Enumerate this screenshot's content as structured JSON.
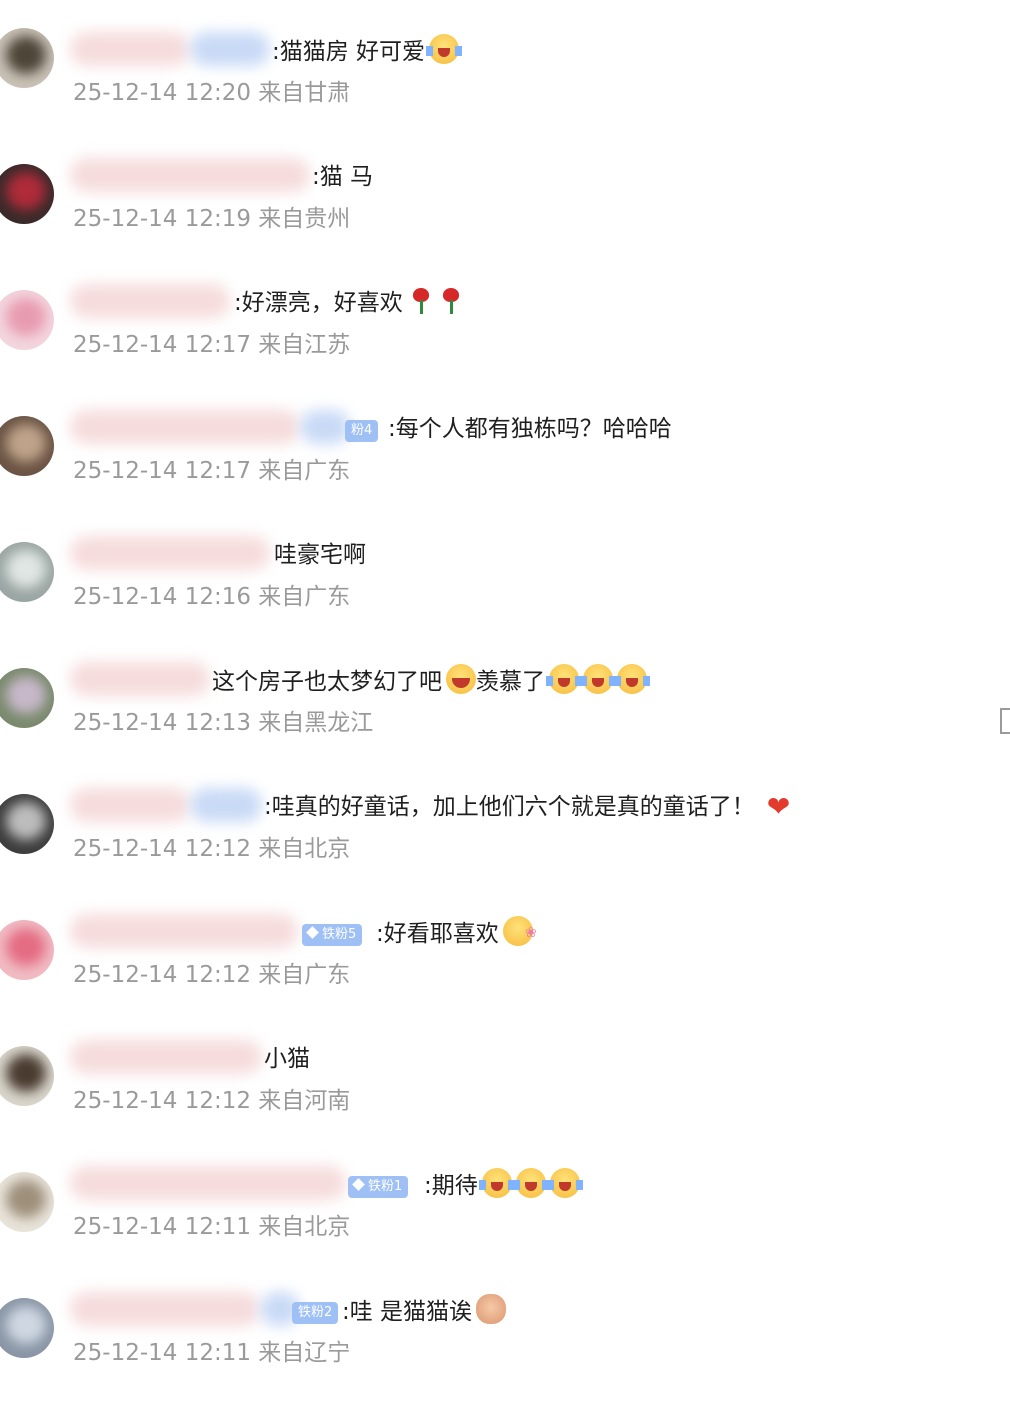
{
  "comments": [
    {
      "id": "c1",
      "text": ":猫猫房 好可爱",
      "emoji": [
        "cry"
      ],
      "badge": "",
      "meta": "25-12-14 12:20 来自甘肃"
    },
    {
      "id": "c2",
      "text": ":猫 马",
      "emoji": [],
      "badge": "",
      "meta": "25-12-14 12:19 来自贵州"
    },
    {
      "id": "c3",
      "text": ":好漂亮，好喜欢",
      "emoji": [
        "rose",
        "rose"
      ],
      "badge": "",
      "meta": "25-12-14 12:17 来自江苏"
    },
    {
      "id": "c4",
      "text": ":每个人都有独栋吗？哈哈哈",
      "emoji": [],
      "badge": "粉4",
      "meta": "25-12-14 12:17 来自广东"
    },
    {
      "id": "c5",
      "text": "哇豪宅啊",
      "emoji": [],
      "badge": "",
      "meta": "25-12-14 12:16 来自广东"
    },
    {
      "id": "c6",
      "text": "这个房子也太梦幻了吧",
      "text2": "羡慕了",
      "emoji": [
        "laugh"
      ],
      "emoji2": [
        "cry",
        "cry",
        "cry"
      ],
      "badge": "",
      "meta": "25-12-14 12:13 来自黑龙江"
    },
    {
      "id": "c7",
      "text": ":哇真的好童话，加上他们六个就是真的童话了！",
      "emoji": [
        "heart"
      ],
      "badge": "",
      "meta": "25-12-14 12:12 来自北京"
    },
    {
      "id": "c8",
      "text": ":好看耶喜欢",
      "emoji": [
        "love"
      ],
      "badge": "铁粉5",
      "meta": "25-12-14 12:12 来自广东"
    },
    {
      "id": "c9",
      "text": "小猫",
      "emoji": [],
      "badge": "",
      "meta": "25-12-14 12:12 来自河南"
    },
    {
      "id": "c10",
      "text": ":期待",
      "emoji": [
        "cry",
        "cry",
        "cry"
      ],
      "badge": "铁粉1",
      "meta": "25-12-14 12:11 来自北京"
    },
    {
      "id": "c11",
      "text": ":哇 是猫猫诶",
      "emoji": [
        "paw"
      ],
      "badge": "铁粉2",
      "meta": "25-12-14 12:11 来自辽宁"
    }
  ]
}
